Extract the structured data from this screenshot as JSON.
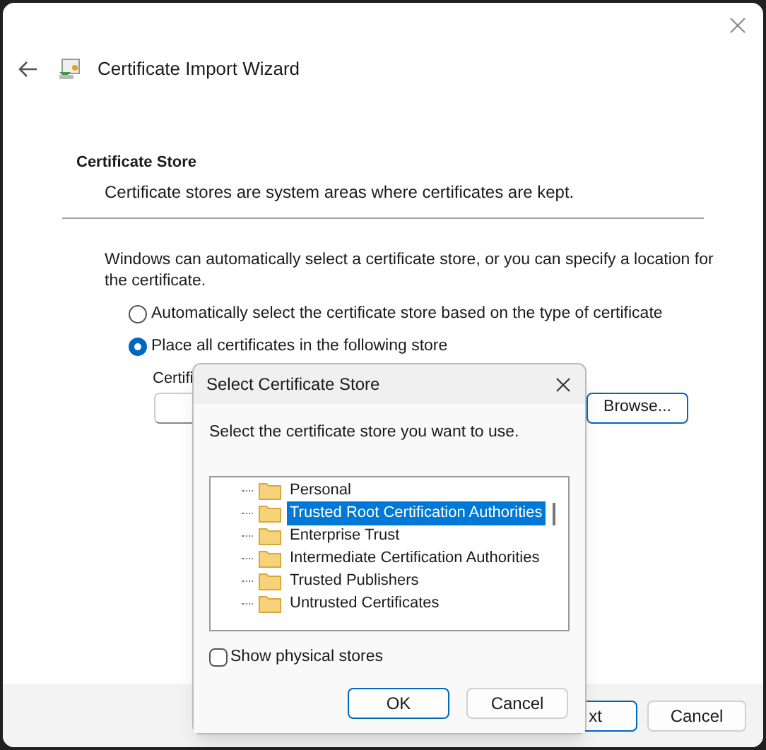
{
  "window": {
    "title": "Certificate Import Wizard"
  },
  "section": {
    "heading": "Certificate Store",
    "subheading": "Certificate stores are system areas where certificates are kept."
  },
  "intro": "Windows can automatically select a certificate store, or you can specify a location for the certificate.",
  "options": [
    {
      "label": "Automatically select the certificate store based on the type of certificate",
      "selected": false
    },
    {
      "label": "Place all certificates in the following store",
      "selected": true
    }
  ],
  "store_label": "Certifi",
  "browse_button": "Browse...",
  "footer_buttons": [
    {
      "label": "xt",
      "kind": "default"
    },
    {
      "label": "Cancel",
      "kind": "normal"
    }
  ],
  "dialog": {
    "title": "Select Certificate Store",
    "prompt": "Select the certificate store you want to use.",
    "stores": [
      {
        "label": "Personal",
        "selected": false
      },
      {
        "label": "Trusted Root Certification Authorities",
        "selected": true
      },
      {
        "label": "Enterprise Trust",
        "selected": false
      },
      {
        "label": "Intermediate Certification Authorities",
        "selected": false
      },
      {
        "label": "Trusted Publishers",
        "selected": false
      },
      {
        "label": "Untrusted Certificates",
        "selected": false
      }
    ],
    "show_physical": {
      "label": "Show physical stores",
      "checked": false
    },
    "buttons": [
      {
        "label": "OK",
        "kind": "default"
      },
      {
        "label": "Cancel",
        "kind": "normal"
      }
    ]
  }
}
